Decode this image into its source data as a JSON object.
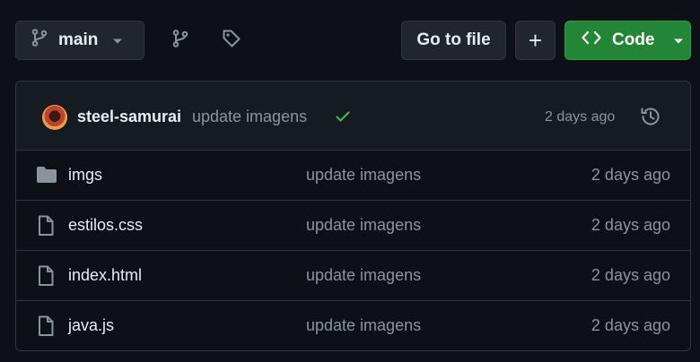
{
  "toolbar": {
    "branch_label": "main",
    "goto_label": "Go to file",
    "plus_symbol": "+",
    "code_label": "Code",
    "accent_color": "#238636"
  },
  "commit": {
    "author": "steel-samurai",
    "message": "update imagens",
    "status": "check-icon",
    "time": "2 days ago"
  },
  "files": [
    {
      "type": "folder",
      "name": "imgs",
      "message": "update imagens",
      "time": "2 days ago"
    },
    {
      "type": "file",
      "name": "estilos.css",
      "message": "update imagens",
      "time": "2 days ago"
    },
    {
      "type": "file",
      "name": "index.html",
      "message": "update imagens",
      "time": "2 days ago"
    },
    {
      "type": "file",
      "name": "java.js",
      "message": "update imagens",
      "time": "2 days ago"
    }
  ]
}
